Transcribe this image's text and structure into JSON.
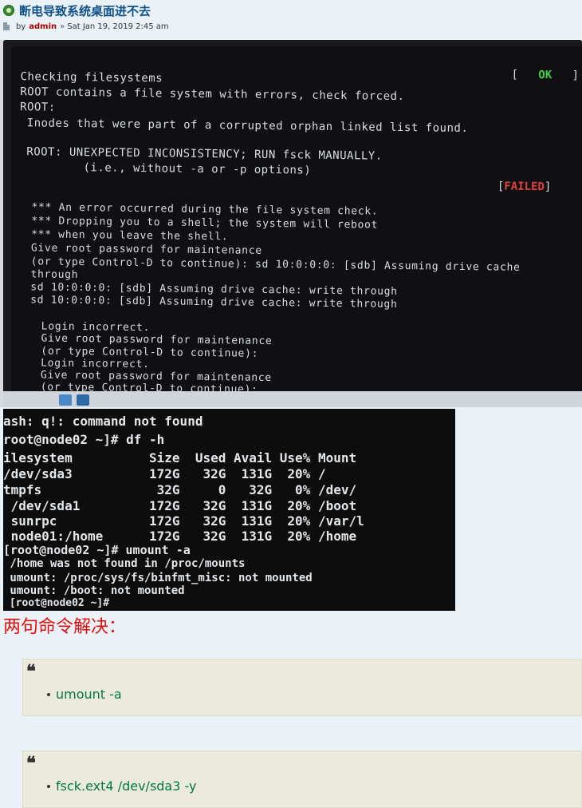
{
  "post": {
    "title": "断电导致系统桌面进不去",
    "by_label": "by",
    "author": "admin",
    "separator": "»",
    "date": "Sat Jan 19, 2019 2:45 am"
  },
  "screen1": {
    "ok_open": "[",
    "ok_label": "OK",
    "ok_close": "]",
    "failed_open": "[",
    "failed_label": "FAILED",
    "failed_close": "]",
    "lines": [
      "Checking filesystems",
      "ROOT contains a file system with errors, check forced.",
      "ROOT:",
      " Inodes that were part of a corrupted orphan linked list found.",
      " ROOT: UNEXPECTED INCONSISTENCY; RUN fsck MANUALLY.",
      "         (i.e., without -a or -p options)",
      "*** An error occurred during the file system check.",
      "*** Dropping you to a shell; the system will reboot",
      "*** when you leave the shell.",
      "Give root password for maintenance",
      "(or type Control-D to continue): sd 10:0:0:0: [sdb] Assuming drive cache",
      "through",
      "sd 10:0:0:0: [sdb] Assuming drive cache: write through",
      "sd 10:0:0:0: [sdb] Assuming drive cache: write through",
      "Login incorrect.",
      "Give root password for maintenance",
      "(or type Control-D to continue):",
      "Login incorrect.",
      "Give root password for maintenance",
      "(or type Control-D to continue):"
    ]
  },
  "screen2": {
    "lines": [
      "ash: q!: command not found",
      "root@node02 ~]# df -h",
      "ilesystem          Size  Used Avail Use% Mount",
      "/dev/sda3          172G   32G  131G  20% /",
      "tmpfs               32G     0   32G   0% /dev/",
      " /dev/sda1         172G   32G  131G  20% /boot",
      " sunrpc            172G   32G  131G  20% /var/l",
      " node01:/home      172G   32G  131G  20% /home",
      "[root@node02 ~]# umount -a",
      " /home was not found in /proc/mounts",
      " umount: /proc/sys/fs/binfmt_misc: not mounted",
      " umount: /boot: not mounted",
      " [root@node02 ~]#"
    ]
  },
  "solution": {
    "heading": "两句命令解决：",
    "quote_mark": "❝",
    "commands": [
      "umount -a",
      "fsck.ext4 /dev/sda3 -y"
    ]
  }
}
